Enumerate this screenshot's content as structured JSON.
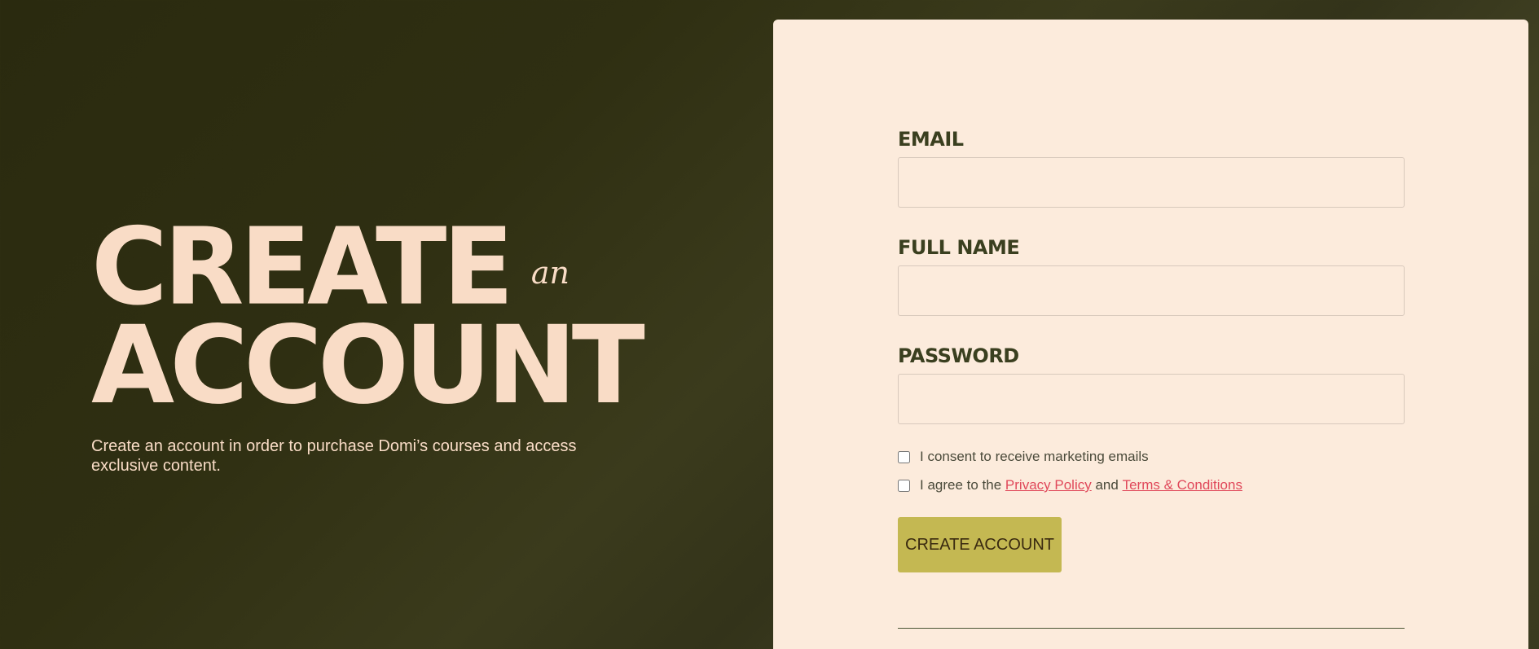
{
  "hero": {
    "title_line1": "CREATE",
    "title_connector": "an",
    "title_line2": "ACCOUNT",
    "subtitle": "Create an account in order to purchase Domi’s courses and access exclusive content."
  },
  "form": {
    "email_label": "EMAIL",
    "email_value": "",
    "full_name_label": "FULL NAME",
    "full_name_value": "",
    "password_label": "PASSWORD",
    "password_value": "",
    "marketing_consent_label": "I consent to receive marketing emails",
    "marketing_consent_checked": false,
    "agree_prefix": "I agree to the",
    "privacy_policy_link": "Privacy Policy",
    "agree_conjunction": "and",
    "terms_link": "Terms & Conditions",
    "agree_checked": false,
    "submit_label": "CREATE ACCOUNT"
  },
  "colors": {
    "background_dark_olive": "#2f2f12",
    "hero_text": "#f9dcc6",
    "panel_background": "#fcebdc",
    "label_text": "#3a3f1f",
    "link": "#e0485a",
    "button_background": "#c4b852"
  }
}
